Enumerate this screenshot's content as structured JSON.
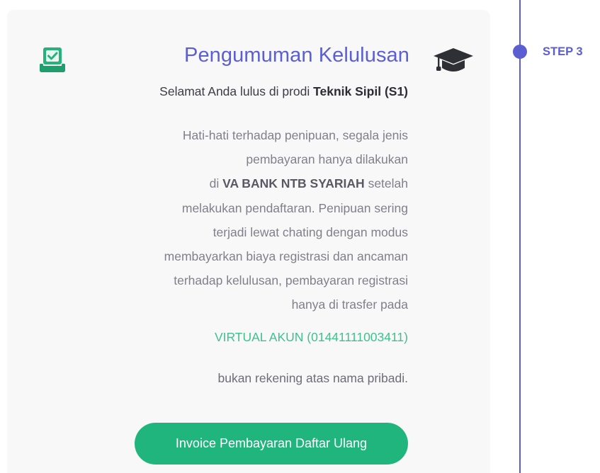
{
  "card": {
    "title": "Pengumuman Kelulusan",
    "subtitle_prefix": "Selamat Anda lulus di prodi ",
    "subtitle_program": "Teknik Sipil (S1)",
    "warning": {
      "line1": "Hati-hati terhadap penipuan, segala jenis",
      "line2": "pembayaran hanya dilakukan",
      "line3_prefix": "di ",
      "line3_bank": "VA BANK NTB SYARIAH",
      "line3_suffix": " setelah",
      "line4": "melakukan pendaftaran. Penipuan sering",
      "line5": "terjadi lewat chating dengan modus",
      "line6": "membayarkan biaya registrasi dan ancaman",
      "line7": "terhadap kelulusan, pembayaran registrasi",
      "line8": "hanya di trasfer pada"
    },
    "virtual_account": "VIRTUAL AKUN (01441111003411)",
    "note": "bukan rekening atas nama pribadi.",
    "invoice_button": "Invoice Pembayaran Daftar Ulang"
  },
  "icons": {
    "check": "checkbox-tray-icon",
    "cap": "graduation-cap-icon"
  },
  "timeline": {
    "step_label": "STEP 3"
  },
  "colors": {
    "accent_purple": "#5a5ed0",
    "title_purple": "#5b5fd3",
    "green": "#21b57e",
    "va_green": "#3fc18d",
    "card_bg": "#f8f8f9"
  }
}
